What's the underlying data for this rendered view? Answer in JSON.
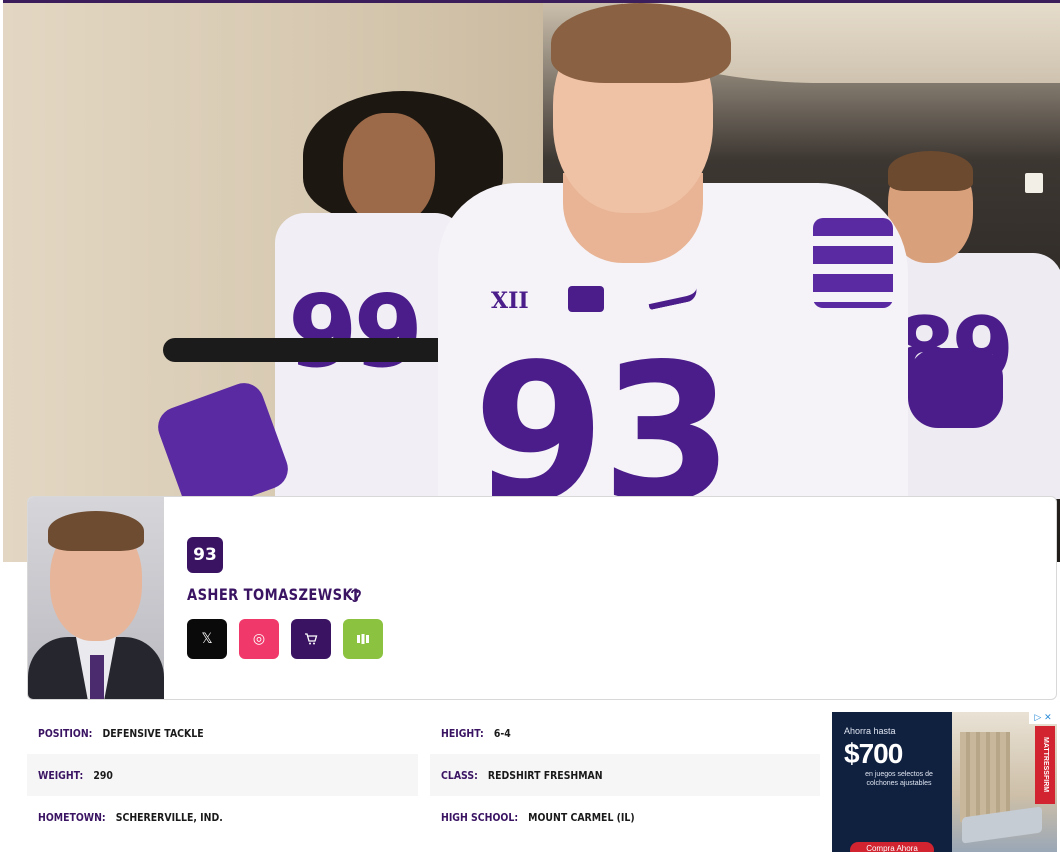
{
  "player": {
    "number": "93",
    "name": "ASHER TOMASZEWSKI",
    "audio_icon": "ear-icon"
  },
  "socials": [
    {
      "name": "x-twitter",
      "icon": "x-icon",
      "glyph": "𝕏",
      "color": "#0a0a0a"
    },
    {
      "name": "instagram",
      "icon": "instagram-icon",
      "glyph": "◎",
      "color": "#f0396a"
    },
    {
      "name": "shop",
      "icon": "cart-icon",
      "glyph": "🛒",
      "color": "#3a1463"
    },
    {
      "name": "nil",
      "icon": "bars-icon",
      "glyph": "▮▮",
      "color": "#8bc23f"
    }
  ],
  "bio": {
    "position_label": "POSITION:",
    "position": "DEFENSIVE TACKLE",
    "height_label": "HEIGHT:",
    "height": "6-4",
    "weight_label": "WEIGHT:",
    "weight": "290",
    "class_label": "CLASS:",
    "class": "REDSHIRT FRESHMAN",
    "hometown_label": "HOMETOWN:",
    "hometown": "SCHERERVILLE, IND.",
    "highschool_label": "HIGH SCHOOL:",
    "highschool": "MOUNT CARMEL (IL)"
  },
  "ad": {
    "small": "Ahorra hasta",
    "price": "$700",
    "sub": "en juegos selectos de colchones ajustables",
    "button": "Compra Ahora",
    "brand": "MATTRESSFIRM",
    "close": "▷ ✕"
  },
  "hero": {
    "jersey_numbers": [
      "99",
      "93",
      "89"
    ],
    "chest_logo_text": "XII"
  },
  "colors": {
    "brand_purple": "#3a1463",
    "instagram": "#f0396a",
    "nil_green": "#8bc23f"
  }
}
